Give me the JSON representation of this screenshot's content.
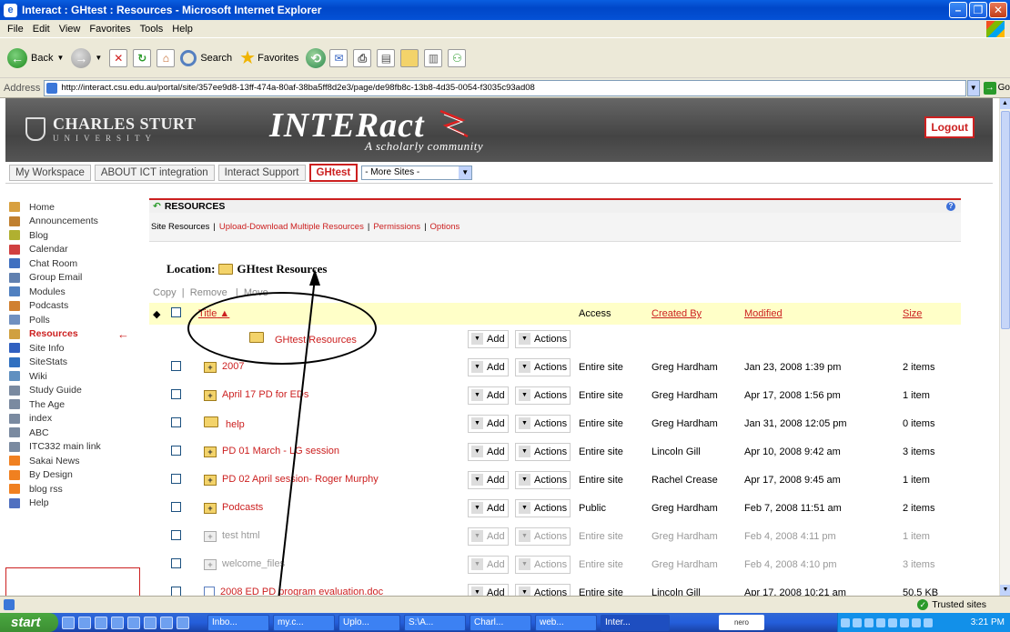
{
  "window": {
    "title": "Interact : GHtest : Resources - Microsoft Internet Explorer"
  },
  "menu": [
    "File",
    "Edit",
    "View",
    "Favorites",
    "Tools",
    "Help"
  ],
  "toolbar": {
    "back": "Back",
    "search": "Search",
    "favorites": "Favorites"
  },
  "address": {
    "label": "Address",
    "url": "http://interact.csu.edu.au/portal/site/357ee9d8-13ff-474a-80af-38ba5ff8d2e3/page/de98fb8c-13b8-4d35-0054-f3035c93ad08",
    "go": "Go"
  },
  "banner": {
    "csu_line1": "CHARLES STURT",
    "csu_line2": "UNIVERSITY",
    "interact": "INTERact",
    "tagline": "A scholarly community",
    "logout": "Logout"
  },
  "sitetabs": [
    "My Workspace",
    "ABOUT ICT integration",
    "Interact Support",
    "GHtest"
  ],
  "more_sites": "- More Sites -",
  "leftnav": [
    {
      "label": "Home",
      "icon": "home-icon",
      "color": "#d8a040"
    },
    {
      "label": "Announcements",
      "icon": "megaphone-icon",
      "color": "#c08030"
    },
    {
      "label": "Blog",
      "icon": "blog-icon",
      "color": "#b0b030"
    },
    {
      "label": "Calendar",
      "icon": "calendar-icon",
      "color": "#d04040"
    },
    {
      "label": "Chat Room",
      "icon": "chat-icon",
      "color": "#4070c0"
    },
    {
      "label": "Group Email",
      "icon": "email-icon",
      "color": "#6080b0"
    },
    {
      "label": "Modules",
      "icon": "modules-icon",
      "color": "#5080c0"
    },
    {
      "label": "Podcasts",
      "icon": "podcast-icon",
      "color": "#d08030"
    },
    {
      "label": "Polls",
      "icon": "polls-icon",
      "color": "#7090c0"
    },
    {
      "label": "Resources",
      "icon": "resources-icon",
      "color": "#d0a040"
    },
    {
      "label": "Site Info",
      "icon": "info-icon",
      "color": "#3060c0"
    },
    {
      "label": "SiteStats",
      "icon": "stats-icon",
      "color": "#3070c0"
    },
    {
      "label": "Wiki",
      "icon": "wiki-icon",
      "color": "#6090c0"
    },
    {
      "label": "Study Guide",
      "icon": "link-icon",
      "color": "#7a8aa0"
    },
    {
      "label": "The Age",
      "icon": "link-icon",
      "color": "#7a8aa0"
    },
    {
      "label": "index",
      "icon": "link-icon",
      "color": "#7a8aa0"
    },
    {
      "label": "ABC",
      "icon": "link-icon",
      "color": "#7a8aa0"
    },
    {
      "label": "ITC332 main link",
      "icon": "link-icon",
      "color": "#7a8aa0"
    },
    {
      "label": "Sakai News",
      "icon": "rss-icon",
      "color": "#f08020"
    },
    {
      "label": "By Design",
      "icon": "rss-icon",
      "color": "#f08020"
    },
    {
      "label": "blog rss",
      "icon": "rss-icon",
      "color": "#f08020"
    },
    {
      "label": "Help",
      "icon": "help-icon",
      "color": "#5070c0"
    }
  ],
  "tool": {
    "title": "RESOURCES",
    "nav_first": "Site Resources",
    "nav_links": [
      "Upload-Download Multiple Resources",
      "Permissions",
      "Options"
    ],
    "location_label": "Location:",
    "location_value": "GHtest Resources",
    "copy": "Copy",
    "remove": "Remove",
    "move": "Move",
    "columns": {
      "title": "Title",
      "access": "Access",
      "created_by": "Created By",
      "modified": "Modified",
      "size": "Size"
    },
    "add": "Add",
    "actions": "Actions",
    "actions_trunc": "Actions",
    "rows": [
      {
        "name": "GHtest Resources",
        "type": "root",
        "access": "",
        "created_by": "",
        "modified": "",
        "size": "",
        "hidden": false
      },
      {
        "name": "2007",
        "type": "folder",
        "access": "Entire site",
        "created_by": "Greg Hardham",
        "modified": "Jan 23, 2008 1:39 pm",
        "size": "2 items",
        "hidden": false
      },
      {
        "name": "April 17 PD for EDs",
        "type": "folder",
        "access": "Entire site",
        "created_by": "Greg Hardham",
        "modified": "Apr 17, 2008 1:56 pm",
        "size": "1 item",
        "hidden": false
      },
      {
        "name": "help",
        "type": "folder-empty",
        "access": "Entire site",
        "created_by": "Greg Hardham",
        "modified": "Jan 31, 2008 12:05 pm",
        "size": "0 items",
        "hidden": false
      },
      {
        "name": "PD 01 March - LG session",
        "type": "folder",
        "access": "Entire site",
        "created_by": "Lincoln Gill",
        "modified": "Apr 10, 2008 9:42 am",
        "size": "3 items",
        "hidden": false
      },
      {
        "name": "PD 02 April session- Roger Murphy",
        "type": "folder",
        "access": "Entire site",
        "created_by": "Rachel Crease",
        "modified": "Apr 17, 2008 9:45 am",
        "size": "1 item",
        "hidden": false
      },
      {
        "name": "Podcasts",
        "type": "folder",
        "access": "Public",
        "created_by": "Greg Hardham",
        "modified": "Feb 7, 2008 11:51 am",
        "size": "2 items",
        "hidden": false
      },
      {
        "name": "test html",
        "type": "folder",
        "access": "Entire site",
        "created_by": "Greg Hardham",
        "modified": "Feb 4, 2008 4:11 pm",
        "size": "1 item",
        "hidden": true
      },
      {
        "name": "welcome_files",
        "type": "folder",
        "access": "Entire site",
        "created_by": "Greg Hardham",
        "modified": "Feb 4, 2008 4:10 pm",
        "size": "3 items",
        "hidden": true
      },
      {
        "name": "2008 ED PD program evaluation.doc",
        "type": "doc",
        "access": "Entire site",
        "created_by": "Lincoln Gill",
        "modified": "Apr 17, 2008 10:21 am",
        "size": "50.5 KB",
        "hidden": false
      }
    ]
  },
  "status": {
    "zone": "Trusted sites"
  },
  "taskbar": {
    "start": "start",
    "tasks": [
      "Inbo...",
      "my.c...",
      "Uplo...",
      "S:\\A...",
      "Charl...",
      "web...",
      "Inter..."
    ],
    "nero": "nero",
    "clock": "3:21 PM"
  }
}
